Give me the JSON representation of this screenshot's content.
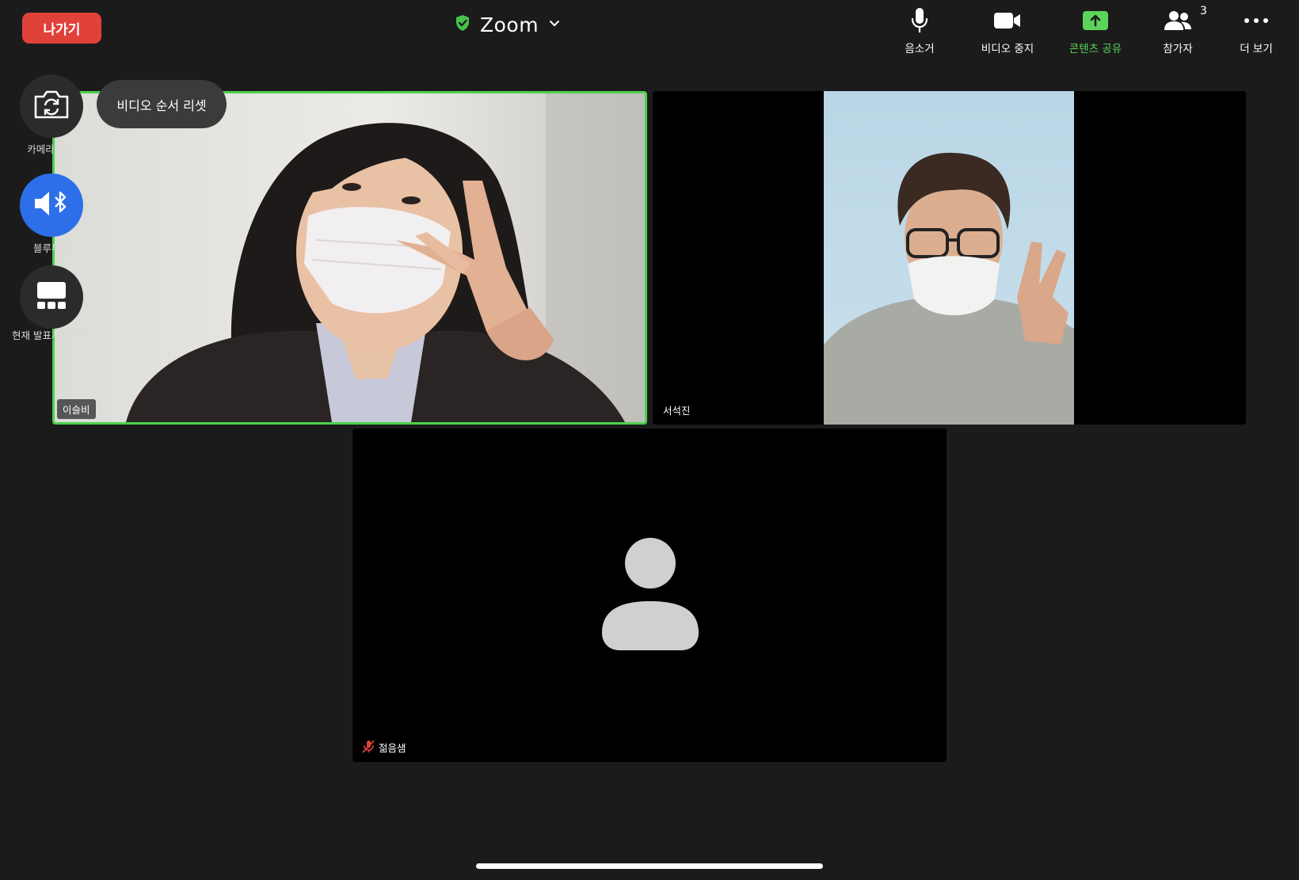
{
  "header": {
    "leave_label": "나가기",
    "app_title": "Zoom"
  },
  "toolbar": {
    "items": [
      {
        "label": "음소거",
        "icon": "microphone-icon"
      },
      {
        "label": "비디오 중지",
        "icon": "video-camera-icon"
      },
      {
        "label": "콘텐츠 공유",
        "icon": "share-screen-icon"
      },
      {
        "label": "참가자",
        "icon": "participants-icon",
        "count": "3"
      },
      {
        "label": "더 보기",
        "icon": "more-icon"
      }
    ]
  },
  "side_controls": {
    "camera_switch_label": "카메라 전환",
    "audio_label": "블루투스",
    "switch_view_label": "현재 발표자로 전환",
    "reset_order_label": "비디오 순서 리셋"
  },
  "participants": [
    {
      "name": "이슬비",
      "video": true,
      "active_speaker": true
    },
    {
      "name": "서석진",
      "video": true,
      "active_speaker": false
    },
    {
      "name": "젊음샘",
      "video": false,
      "muted": true
    }
  ],
  "colors": {
    "leave_red": "#e0423a",
    "share_green": "#5bd45b",
    "active_border": "#4cd24c",
    "bluetooth_blue": "#2d6fe8",
    "shield_green": "#46c34a"
  }
}
